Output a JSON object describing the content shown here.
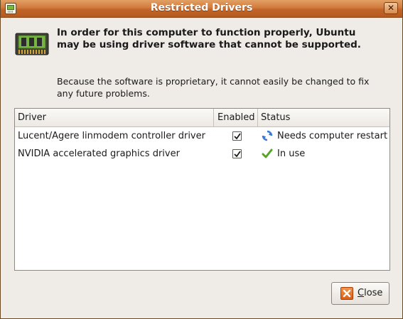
{
  "window": {
    "title": "Restricted Drivers",
    "close_glyph": "✕"
  },
  "message": {
    "heading": "In order for this computer to function properly, Ubuntu may be using driver software that cannot be supported.",
    "body": "Because the software is proprietary, it cannot easily be changed to fix any future problems."
  },
  "table": {
    "columns": [
      "Driver",
      "Enabled",
      "Status"
    ],
    "rows": [
      {
        "driver": "Lucent/Agere linmodem controller driver",
        "enabled": true,
        "status": "Needs computer restart",
        "status_icon": "refresh-icon"
      },
      {
        "driver": "NVIDIA accelerated graphics driver",
        "enabled": true,
        "status": "In use",
        "status_icon": "checkmark-icon"
      }
    ]
  },
  "buttons": {
    "close_label": "Close"
  },
  "colors": {
    "titlebar": "#c8692c",
    "window_bg": "#efebe7",
    "check_green": "#58a32a",
    "restart_blue": "#3a7bd5"
  }
}
